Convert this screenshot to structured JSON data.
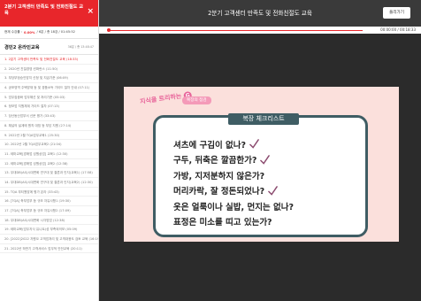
{
  "sidebar": {
    "header_title": "2분기 고객센터 만족도 및 전화친절도 교육",
    "close_label": "×",
    "progress": {
      "label": "현재 수강률 :",
      "percent": "0.00%",
      "position": "/ 6분 / 총 18강 / 01:45:52"
    },
    "course": {
      "title": "경민2 온라인교육",
      "meta": "36분 / 총 13:48:47"
    },
    "chapters": [
      "1. 2분기 고객센터 만족도 및 전화친절도 교육 (18:33)",
      "2. 2020년 친절경영 컨퍼런스 (11:50)",
      "3. 부당부정승인방지 신청 및 지급기준 (06:09)",
      "4. 공포영역 주택방재 등 및 경품소득 가이드 절차 안내 (07:11)",
      "5. 업무집중화 업무해선 및 처리기준 (05:03)",
      "6. 정보업 지원체계 가이드 절차 (07:13)",
      "7. 당산동산업부서 신문 평가 (33:43)",
      "8. 채널의 설계에 원칙 대칭 등 부담 지원 (27:14)",
      "9. 2022년 2월 TQA업무교육1 (25:30)",
      "10. 2022년 2월 TQA업무교육2 (21:04)",
      "11. 테마교육[경매업 성원상업] 교육1 (12:30)",
      "12. 테마교육[경매업 성원상업] 교육2 (12:38)",
      "13. 우대DB(AS)시대변화 연구대 및 결론과 인지(교육1) (17:58)",
      "14. 우대DB(AS)시대변화 연구대 및 결론과 인지(교육2) (12:30)",
      "15. TQA 부티원맞에 평가 온라 (33:43)",
      "16. [TQA] 축부업부 등 규모 자유사항1 (19:30)",
      "17. [TQA] 축부업부 등 규모 자유사항2 (17:09)",
      "18. 우대DB(AS)시대변화 시각방업 (12:38)",
      "19. 테마교육(업무지식 유니트)성 부족외의보 (05:09)",
      "20. [2022]2022 자원오 고객업처리 및 고객대응도 검토 교육 (16:19)",
      "21. 2022년 하반기 고객서비스 업무적 안전교육 (20:11)"
    ]
  },
  "header": {
    "title": "2분기 고객센터 만족도 및 전화친절도 교육",
    "hide_button": "플리가기"
  },
  "player": {
    "time": "00:00:00 / 00:18:33"
  },
  "slide": {
    "logo_text": "지식을 트리하는",
    "logo_letter": "G",
    "tag": "복장의 점검",
    "card_title": "복장 체크리스트",
    "items": [
      {
        "text": "셔츠에 구김이 없나?",
        "checked": true
      },
      {
        "text": "구두, 뒤축은 깔끔한가?",
        "checked": true
      },
      {
        "text": "가방, 지저분하지 않은가?",
        "checked": false
      },
      {
        "text": "머리카락, 잘 정돈되었나?",
        "checked": true
      },
      {
        "text": "옷은 얼룩이나 실밥, 먼지는 없나?",
        "checked": false
      },
      {
        "text": "표정은 미소를 띠고 있는가?",
        "checked": false
      }
    ]
  },
  "colors": {
    "brand_red": "#e8262b",
    "card_dark": "#3f5d64",
    "slide_bg": "#fbe0dc"
  }
}
